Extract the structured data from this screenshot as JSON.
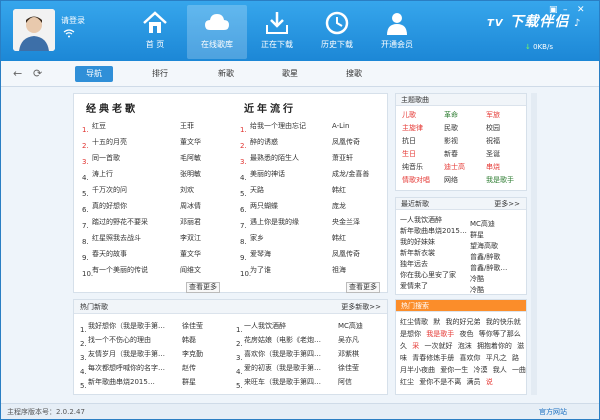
{
  "header": {
    "login_text": "请登录",
    "nav": [
      {
        "label": "首 页",
        "icon": "home-icon"
      },
      {
        "label": "在线歌库",
        "icon": "cloud-icon"
      },
      {
        "label": "正在下载",
        "icon": "download-icon"
      },
      {
        "label": "历史下载",
        "icon": "history-icon"
      },
      {
        "label": "开通会员",
        "icon": "member-icon"
      }
    ],
    "brand": "下载伴侣",
    "speed": "0KB/s"
  },
  "tabs": [
    "导航",
    "排行",
    "新歌",
    "歌星",
    "搜歌"
  ],
  "classic": {
    "title": "经典老歌",
    "more": "查看更多",
    "rows": [
      {
        "n": "1.",
        "song": "红豆",
        "artist": "王菲"
      },
      {
        "n": "2.",
        "song": "十五的月亮",
        "artist": "董文华"
      },
      {
        "n": "3.",
        "song": "同一首歌",
        "artist": "毛阿敏"
      },
      {
        "n": "4.",
        "song": "涛上行",
        "artist": "张明敏"
      },
      {
        "n": "5.",
        "song": "千万次的问",
        "artist": "刘欢"
      },
      {
        "n": "6.",
        "song": "真的好想你",
        "artist": "周冰倩"
      },
      {
        "n": "7.",
        "song": "踏过的野花不要采",
        "artist": "邓丽君"
      },
      {
        "n": "8.",
        "song": "红星照我去战斗",
        "artist": "李双江"
      },
      {
        "n": "9.",
        "song": "春天的故事",
        "artist": "董文华"
      },
      {
        "n": "10.",
        "song": "有一个美丽的传说",
        "artist": "阎维文"
      }
    ]
  },
  "recent": {
    "title": "近年流行",
    "more": "查看更多",
    "rows": [
      {
        "n": "1.",
        "song": "给我一个理由忘记",
        "artist": "A-Lin"
      },
      {
        "n": "2.",
        "song": "醉的诱惑",
        "artist": "凤凰传奇"
      },
      {
        "n": "3.",
        "song": "最熟悉的陌生人",
        "artist": "萧亚轩"
      },
      {
        "n": "4.",
        "song": "美丽的神话",
        "artist": "成龙/金喜善"
      },
      {
        "n": "5.",
        "song": "天路",
        "artist": "韩红"
      },
      {
        "n": "6.",
        "song": "两只蝴蝶",
        "artist": "庞龙"
      },
      {
        "n": "7.",
        "song": "遇上你是我的缘",
        "artist": "央金兰泽"
      },
      {
        "n": "8.",
        "song": "家乡",
        "artist": "韩红"
      },
      {
        "n": "9.",
        "song": "爱琴海",
        "artist": "凤凰传奇"
      },
      {
        "n": "10.",
        "song": "为了谁",
        "artist": "祖海"
      }
    ]
  },
  "hot_new": {
    "title": "热门新歌",
    "more": "更多新歌>>",
    "left": [
      {
        "n": "1.",
        "song": "我好想你（我是歌手第…",
        "artist": "徐佳莹"
      },
      {
        "n": "2.",
        "song": "找一个不伤心的理由",
        "artist": "韩磊"
      },
      {
        "n": "3.",
        "song": "友情岁月（我是歌手第…",
        "artist": "李克勤"
      },
      {
        "n": "4.",
        "song": "每次都想呼喊你的名字…",
        "artist": "赵传"
      },
      {
        "n": "5.",
        "song": "新年歌曲串烧2015…",
        "artist": "群星"
      }
    ],
    "right": [
      {
        "n": "1.",
        "song": "一人我饮酒醉",
        "artist": "MC高迪"
      },
      {
        "n": "2.",
        "song": "花房姑娘（电影《老炮…",
        "artist": "吴亦凡"
      },
      {
        "n": "3.",
        "song": "喜欢你（我是歌手第四…",
        "artist": "邓紫棋"
      },
      {
        "n": "4.",
        "song": "爱的初衷（我是歌手第…",
        "artist": "徐佳莹"
      },
      {
        "n": "5.",
        "song": "来旺车（我是歌手第四…",
        "artist": "阿信"
      }
    ]
  },
  "theme": {
    "title": "主题歌曲",
    "items": [
      {
        "t": "儿歌",
        "c": "#e53935"
      },
      {
        "t": "革命",
        "c": "#2e7d32"
      },
      {
        "t": "军旅",
        "c": "#e53935"
      },
      {
        "t": "主旋律",
        "c": "#e53935"
      },
      {
        "t": "民歌",
        "c": "#333333"
      },
      {
        "t": "校园",
        "c": "#333333"
      },
      {
        "t": "抗日",
        "c": "#333333"
      },
      {
        "t": "影视",
        "c": "#333333"
      },
      {
        "t": "祝福",
        "c": "#333333"
      },
      {
        "t": "生日",
        "c": "#e53935"
      },
      {
        "t": "新春",
        "c": "#333333"
      },
      {
        "t": "圣诞",
        "c": "#333333"
      },
      {
        "t": "纯音乐",
        "c": "#333333"
      },
      {
        "t": "迪士高",
        "c": "#e53935"
      },
      {
        "t": "串烧",
        "c": "#e53935"
      },
      {
        "t": "情歌对唱",
        "c": "#e53935"
      },
      {
        "t": "网络",
        "c": "#333333"
      },
      {
        "t": "我是歌手",
        "c": "#2e7d32"
      }
    ]
  },
  "latest": {
    "title": "最近新歌",
    "more": "更多>>",
    "rows": [
      {
        "s": "一人我饮酒醉",
        "a": "MC高迪"
      },
      {
        "s": "新年歌曲串烧2015…",
        "a": "群星"
      },
      {
        "s": "我的好妹妹",
        "a": "望海高歌"
      },
      {
        "s": "新年新衣裳",
        "a": "曾鑫/醉歌"
      },
      {
        "s": "独年远去",
        "a": "曾鑫/醉歌…"
      },
      {
        "s": "你在我心里安了家",
        "a": "冷酷"
      },
      {
        "s": "爱情来了",
        "a": "冷酷"
      }
    ]
  },
  "hot_search": {
    "title": "热门搜索",
    "words": [
      {
        "t": "红尘情歌",
        "c": "#333333"
      },
      {
        "t": "默",
        "c": "#333333"
      },
      {
        "t": "我的好兄弟",
        "c": "#333333"
      },
      {
        "t": "我的快乐就",
        "c": "#333333"
      },
      {
        "t": "是想你",
        "c": "#333333"
      },
      {
        "t": "我是歌手",
        "c": "#e53935"
      },
      {
        "t": "夜色",
        "c": "#333333"
      },
      {
        "t": "等你等了那么",
        "c": "#333333"
      },
      {
        "t": "久",
        "c": "#333333"
      },
      {
        "t": "采",
        "c": "#e53935"
      },
      {
        "t": "一次就好",
        "c": "#333333"
      },
      {
        "t": "泡沫",
        "c": "#333333"
      },
      {
        "t": "拥抱着你的",
        "c": "#333333"
      },
      {
        "t": "滋味",
        "c": "#333333"
      },
      {
        "t": "青春修炼手册",
        "c": "#333333"
      },
      {
        "t": "喜欢你",
        "c": "#333333"
      },
      {
        "t": "平凡之",
        "c": "#333333"
      },
      {
        "t": "路",
        "c": "#333333"
      },
      {
        "t": "月半小夜曲",
        "c": "#333333"
      },
      {
        "t": "爱你一生",
        "c": "#333333"
      },
      {
        "t": "冷漠",
        "c": "#333333"
      },
      {
        "t": "我人",
        "c": "#333333"
      },
      {
        "t": "一曲红尘",
        "c": "#333333"
      },
      {
        "t": "爱你不是不离",
        "c": "#333333"
      },
      {
        "t": "满员",
        "c": "#333333"
      },
      {
        "t": "说",
        "c": "#e53935"
      }
    ]
  },
  "status": {
    "version": "主程序版本号：2.0.2.47",
    "site": "官方网站"
  }
}
